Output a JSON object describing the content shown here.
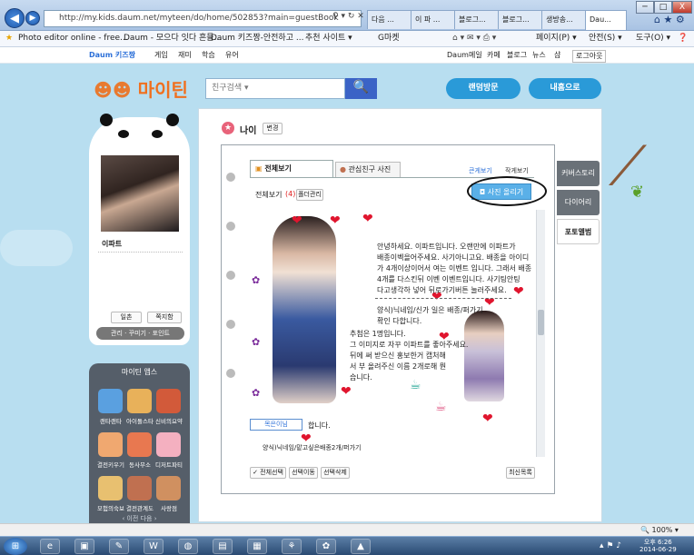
{
  "browser": {
    "url": "http://my.kids.daum.net/myteen/do/home/502853?main=guestBook",
    "tabs": [
      "다음 ...",
      "이 파 ...",
      "블로그...",
      "블로그...",
      "생방송...",
      "Dau..."
    ],
    "window_buttons": [
      "─",
      "□",
      "X"
    ],
    "favorites_label": "Photo editor online - free...",
    "favorites": [
      "Daum - 모으다 잇다 흔들...",
      "Daum 키즈짱-안전하고 ...",
      "추천 사이트 ▾",
      "G마켓"
    ],
    "commands": [
      "페이지(P) ▾",
      "안전(S) ▾",
      "도구(O) ▾"
    ],
    "zoom": "100%",
    "time": "오후 6:26",
    "date": "2014-06-29"
  },
  "site": {
    "nav_logo": "Daum 키즈짱",
    "nav_items": [
      "게임",
      "재미",
      "학습",
      "유어"
    ],
    "nav_right": [
      "Daum",
      "메일",
      "카페",
      "블로그",
      "뉴스",
      "샵",
      "로그아웃"
    ],
    "title": "마이틴",
    "search_select": "친구검색 ▾",
    "search_button": "🔍",
    "random_visit": "랜덤방문",
    "my_home": "내홈으로"
  },
  "profile": {
    "name": "이파트",
    "buttons": [
      "일촌",
      "쪽지함"
    ],
    "menu": [
      "관리",
      "꾸미기",
      "포인트"
    ]
  },
  "apps": {
    "title": "마이틴 앱스",
    "items": [
      {
        "label": "랜타랜타",
        "color": "#5aa0e0"
      },
      {
        "label": "아이돌스타",
        "color": "#e8b15a"
      },
      {
        "label": "신비의요약",
        "color": "#d25a3a"
      },
      {
        "label": "결전키우기",
        "color": "#f0a870"
      },
      {
        "label": "동사무소",
        "color": "#e87850"
      },
      {
        "label": "디저트파티",
        "color": "#f4b0c0"
      },
      {
        "label": "모험의숙보",
        "color": "#e8c070"
      },
      {
        "label": "결전관계도",
        "color": "#c07050"
      },
      {
        "label": "사랑점",
        "color": "#d09060"
      }
    ],
    "paging": "‹ 이전   다음 ›"
  },
  "main": {
    "header_title": "나이",
    "header_edit": "변경",
    "tab_all": "전체보기",
    "tab_photos": "관심친구 사진",
    "view_options": [
      "큰게보기",
      "작게보기"
    ],
    "all_count_label": "전체보기",
    "all_count": "(4)",
    "folder_manage": "폴더관리",
    "upload_photo": "사진 올리기",
    "side_tabs": [
      "커버스토리",
      "다이어리",
      "포토앨범"
    ],
    "text_lines": [
      "안녕하세요. 이파트입니다. 오랜만에 이파트가",
      "배종이벡을어주세요. 사기아니고요. 배종을 아이디",
      "가 4개이상이어서 여는 이벤트 입니다. 그래서 배종",
      "4개를 다스킨뒤 이벤 이벤트입니다. 사기팅안팅",
      "다고생각하 넣어 뒤로가기버튼 눌러주세요.",
      "양식)닉네임/신가 일은 배종/퍼가기",
      "확인 다합니다.",
      "추첨은 1명입니다.",
      "그 이미지로 자꾸 이파트를 좋아주세요.",
      "뒤에 써 받으신 홍보한거 캡처해",
      "서 부 올려주신 이름 2개로해 뭔",
      "습니다.",
      "합니다.",
      "양식)닉네임/맡고싶은배종2개/퍼가기"
    ],
    "nick_button": "목은이님",
    "footer_buttons": [
      "전체선택",
      "선택이동",
      "선택삭제"
    ],
    "recent_list": "최신목록"
  }
}
